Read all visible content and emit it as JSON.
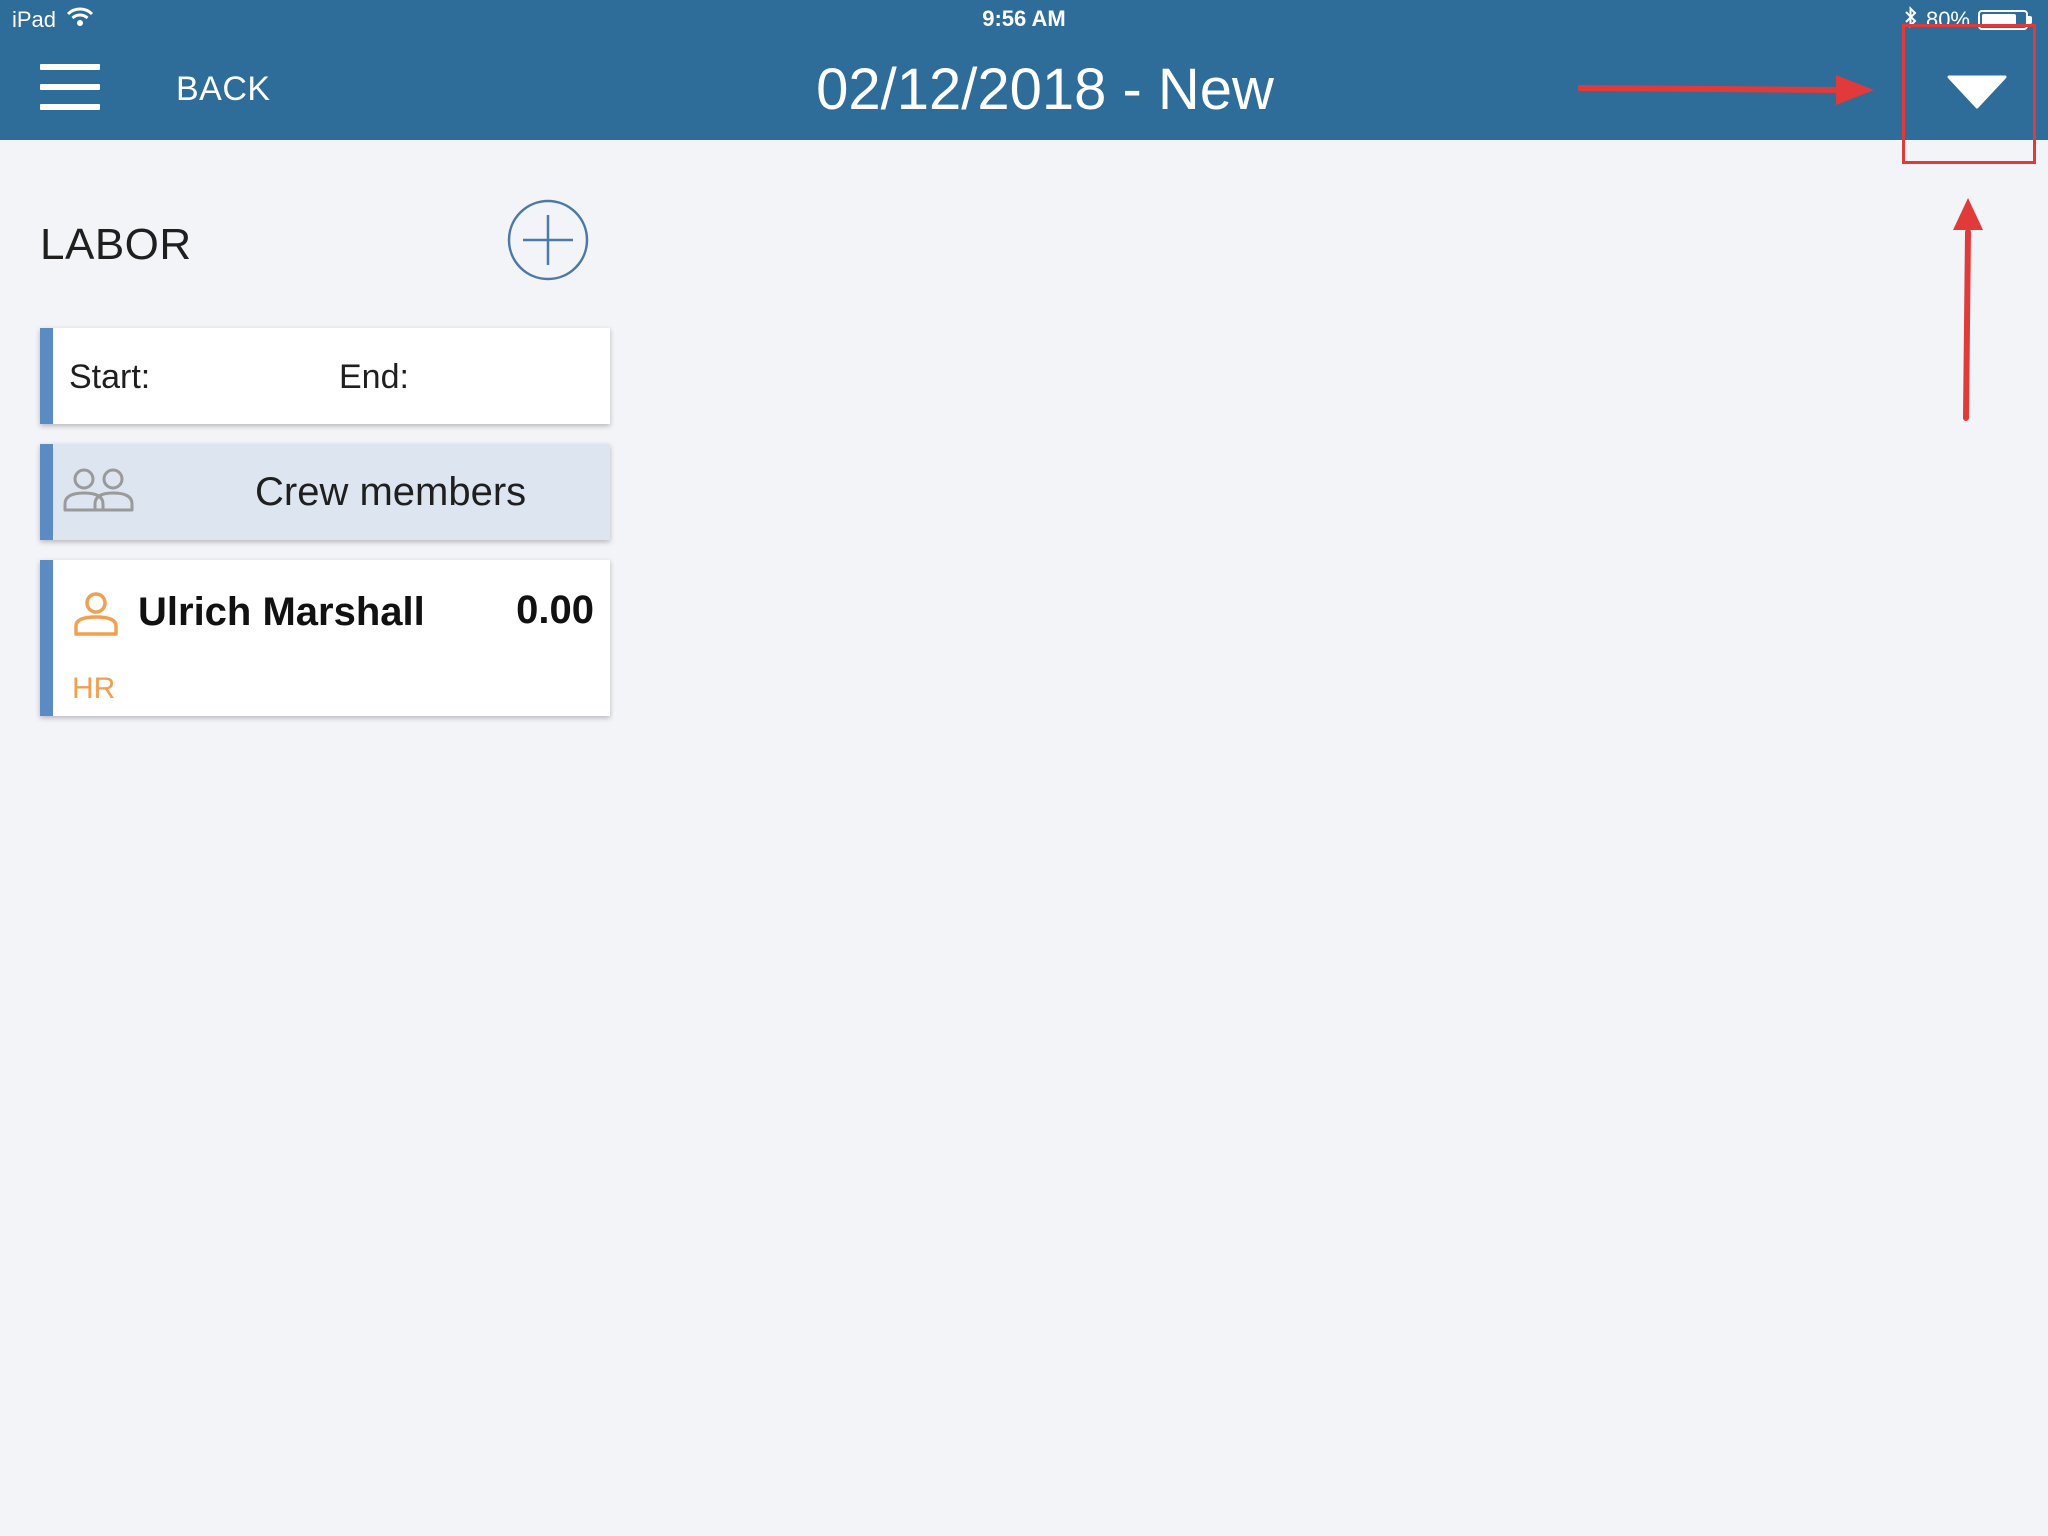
{
  "status_bar": {
    "device": "iPad",
    "time": "9:56 AM",
    "battery_percent": "80%",
    "battery_level": 0.8,
    "wifi_icon": "wifi-icon",
    "bluetooth_icon": "bluetooth-icon"
  },
  "header": {
    "back_label": "BACK",
    "title": "02/12/2018 - New",
    "menu_icon": "hamburger-menu-icon",
    "dropdown_icon": "triangle-down-icon",
    "background_color": "#2e6c99"
  },
  "labor": {
    "section_title": "LABOR",
    "add_icon": "plus-circle-icon",
    "start_label": "Start:",
    "end_label": "End:",
    "crew_label": "Crew members",
    "crew_icon": "people-group-icon",
    "members": [
      {
        "name": "Ulrich Marshall",
        "hours": "0.00",
        "role": "HR",
        "icon": "person-icon"
      }
    ]
  },
  "colors": {
    "accent_border": "#5a8cc3",
    "member_icon": "#f0a050",
    "annotation": "#e03a3a"
  }
}
